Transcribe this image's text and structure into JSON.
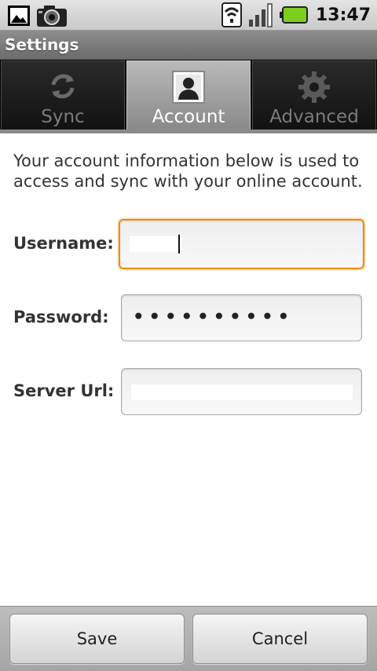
{
  "status_bar": {
    "time": "13:47",
    "icons": [
      "gallery-notification-icon",
      "camera-notification-icon",
      "wifi-icon",
      "signal-icon",
      "battery-icon"
    ]
  },
  "title_bar": {
    "title": "Settings"
  },
  "tabs": [
    {
      "label": "Sync",
      "icon": "sync-icon",
      "selected": false
    },
    {
      "label": "Account",
      "icon": "account-icon",
      "selected": true
    },
    {
      "label": "Advanced",
      "icon": "gear-icon",
      "selected": false
    }
  ],
  "account": {
    "intro": "Your account information below is used to access and sync with your online account.",
    "username": {
      "label": "Username:"
    },
    "password": {
      "label": "Password:",
      "value": "••••••••••"
    },
    "server_url": {
      "label": "Server Url:"
    }
  },
  "buttons": {
    "save": "Save",
    "cancel": "Cancel"
  },
  "colors": {
    "focus_border": "#f08a10",
    "selected_tab": "#9f9f9f",
    "battery": "#7ccf1f"
  }
}
